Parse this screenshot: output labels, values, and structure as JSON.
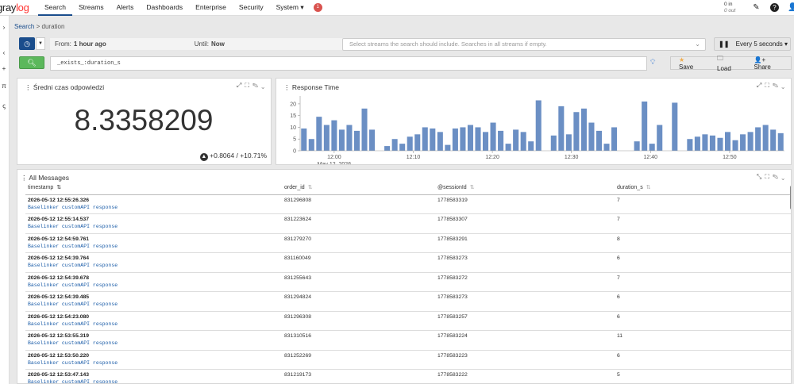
{
  "nav": {
    "logo_a": "gray",
    "logo_b": "log",
    "items": [
      "Search",
      "Streams",
      "Alerts",
      "Dashboards",
      "Enterprise",
      "Security",
      "System ▾"
    ],
    "notification_count": "1",
    "throughput_in": "0 in",
    "throughput_out": "0 out",
    "icons": [
      "edit-icon",
      "help-icon",
      "user-icon"
    ]
  },
  "leftbar": [
    "›",
    "‹",
    "+",
    "π",
    "ꞔ"
  ],
  "breadcrumb": {
    "root": "Search",
    "sep": ">",
    "current": "duration"
  },
  "search": {
    "from_label": "From:",
    "from_value": "1 hour ago",
    "until_label": "Until:",
    "until_value": "Now",
    "streams_placeholder": "Select streams the search should include. Searches in all streams if empty.",
    "refresh_label": "Every 5 seconds ▾",
    "query": "_exists_:duration_s",
    "save_label": "Save",
    "load_label": "Load",
    "share_label": "Share"
  },
  "stat_widget": {
    "title": "Średni czas odpowiedzi",
    "value": "8.3358209",
    "trend": "+0.8064 / +10.71%"
  },
  "chart_data": {
    "type": "bar",
    "title": "Response Time",
    "ylim": [
      0,
      22
    ],
    "yticks": [
      0,
      5,
      10,
      15,
      20
    ],
    "xtick_labels": [
      "12:00",
      "12:10",
      "12:20",
      "12:30",
      "12:40",
      "12:50"
    ],
    "x_sublabel": "May 12, 2026",
    "values": [
      9.5,
      5,
      14.5,
      11,
      13,
      9,
      11,
      8.5,
      18,
      9,
      0,
      2,
      5,
      3,
      6,
      7,
      10,
      9.5,
      8,
      2.5,
      9.5,
      10,
      11,
      10,
      8,
      12,
      8.5,
      3,
      9,
      8,
      4,
      21.5,
      0,
      6.5,
      19,
      7,
      16.5,
      18,
      12,
      8.5,
      3,
      10,
      0,
      0,
      4,
      21,
      3,
      11,
      0,
      20.5,
      0,
      5,
      6,
      7,
      6.5,
      5.5,
      8,
      4.5,
      7,
      8,
      10,
      11,
      9,
      7.5
    ],
    "bar_color": "#6b8fc4"
  },
  "messages": {
    "title": "All Messages",
    "columns": [
      "timestamp",
      "order_id",
      "@sessionId",
      "duration_s"
    ],
    "rows": [
      {
        "timestamp": "2026-05-12 12:55:26.326",
        "message": "Baselinker customAPI response",
        "order_id": "831296808",
        "session": "1778583319",
        "duration": "7"
      },
      {
        "timestamp": "2026-05-12 12:55:14.537",
        "message": "Baselinker customAPI response",
        "order_id": "831223624",
        "session": "1778583307",
        "duration": "7"
      },
      {
        "timestamp": "2026-05-12 12:54:59.761",
        "message": "Baselinker customAPI response",
        "order_id": "831279270",
        "session": "1778583291",
        "duration": "8"
      },
      {
        "timestamp": "2026-05-12 12:54:39.764",
        "message": "Baselinker customAPI response",
        "order_id": "831160049",
        "session": "1778583273",
        "duration": "6"
      },
      {
        "timestamp": "2026-05-12 12:54:39.678",
        "message": "Baselinker customAPI response",
        "order_id": "831255643",
        "session": "1778583272",
        "duration": "7"
      },
      {
        "timestamp": "2026-05-12 12:54:39.485",
        "message": "Baselinker customAPI response",
        "order_id": "831294824",
        "session": "1778583273",
        "duration": "6"
      },
      {
        "timestamp": "2026-05-12 12:54:23.080",
        "message": "Baselinker customAPI response",
        "order_id": "831296308",
        "session": "1778583257",
        "duration": "6"
      },
      {
        "timestamp": "2026-05-12 12:53:55.319",
        "message": "Baselinker customAPI response",
        "order_id": "831310516",
        "session": "1778583224",
        "duration": "11"
      },
      {
        "timestamp": "2026-05-12 12:53:50.220",
        "message": "Baselinker customAPI response",
        "order_id": "831252269",
        "session": "1778583223",
        "duration": "6"
      },
      {
        "timestamp": "2026-05-12 12:53:47.143",
        "message": "Baselinker customAPI response",
        "order_id": "831219173",
        "session": "1778583222",
        "duration": "5"
      }
    ]
  }
}
